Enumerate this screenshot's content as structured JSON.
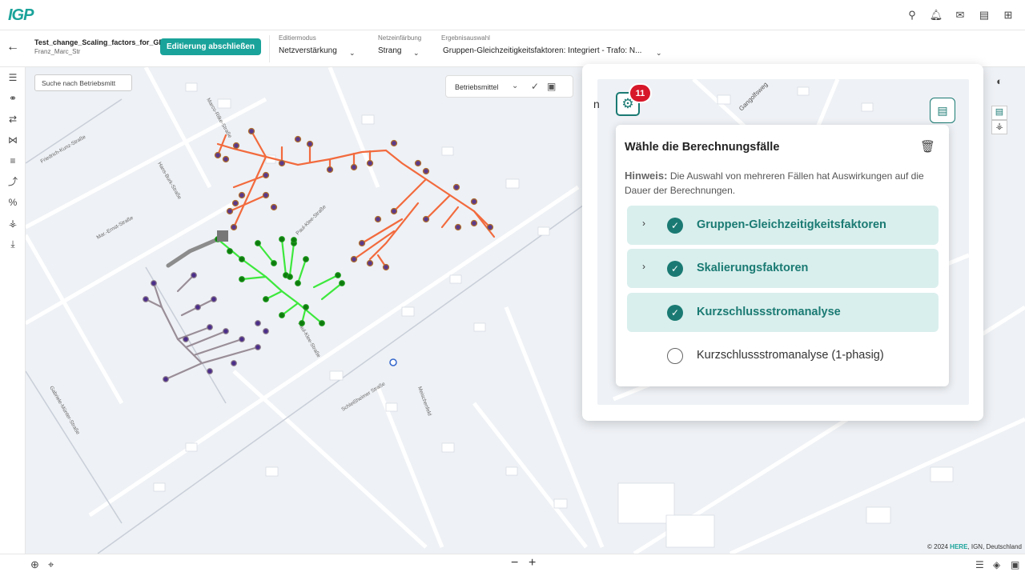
{
  "app": {
    "logo": "IGP"
  },
  "topbar_icons": [
    "graph-icon",
    "bell-icon",
    "mail-icon",
    "document-icon",
    "apps-grid-icon"
  ],
  "toolbar": {
    "back": "←",
    "project_name": "Test_change_Scaling_factors_for_GP",
    "project_user": "Franz_Marc_Str",
    "finish_label": "Editierung abschließen",
    "edit_mode": {
      "label": "Editiermodus",
      "value": "Netzverstärkung"
    },
    "network_coloring": {
      "label": "Netzeinfärbung",
      "value": "Strang"
    },
    "result_selection": {
      "label": "Ergebnisauswahl",
      "value": "Gruppen-Gleichzeitigkeitsfaktoren: Integriert - Trafo: N..."
    }
  },
  "map": {
    "search_placeholder": "Suche nach Betriebsmitt",
    "tool_label": "Betriebsmittel",
    "copyright_year": "© 2024",
    "copyright_brand": "HERE",
    "copyright_rest": ", IGN, Deutschland",
    "street_labels": [
      "Mar.-Ernst-Straße",
      "Friedrich-Kunz-Straße",
      "Hans-Burk-Straße",
      "Schleißheimer Straße",
      "Meischenfeld",
      "Gabriele-Münter-Straße",
      "Paul-Klee-Straße",
      "Paul-Klee-Straße",
      "Gangolfsweg",
      "Marco-Rilke-Straße"
    ]
  },
  "panel": {
    "partial_label": "n",
    "badge_count": "11",
    "dialog_title": "Wähle die Berechnungsfälle",
    "hint_label": "Hinweis:",
    "hint_text": "Die Auswahl von mehreren Fällen hat Auswirkungen auf die Dauer der Berechnungen.",
    "cases": [
      {
        "label": "Gruppen-Gleichzeitigkeitsfaktoren",
        "checked": true,
        "expandable": true
      },
      {
        "label": "Skalierungsfaktoren",
        "checked": true,
        "expandable": true
      },
      {
        "label": "Kurzschlussstromanalyse",
        "checked": true,
        "expandable": false
      },
      {
        "label": "Kurzschlussstromanalyse (1-phasig)",
        "checked": false,
        "expandable": false
      }
    ]
  },
  "colors": {
    "accent": "#1aa39a",
    "accent_dark": "#1a7a73",
    "badge": "#d7182a",
    "orange_net": "#f26a3d",
    "green_net": "#3de83d",
    "gray_net": "#9a8e98"
  }
}
